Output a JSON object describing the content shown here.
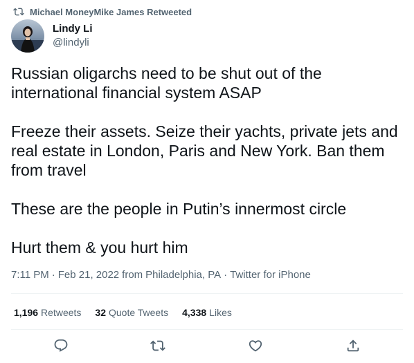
{
  "retweet_context": {
    "icon": "retweet-icon",
    "text": "Michael MoneyMike James Retweeted"
  },
  "author": {
    "display_name": "Lindy Li",
    "handle": "@lindyli",
    "avatar": "avatar-photo"
  },
  "tweet": {
    "paragraphs": [
      "Russian oligarchs need to be shut out of the international financial system ASAP",
      "Freeze their assets. Seize their yachts, private jets and real estate in London, Paris and New York. Ban them from travel",
      "These are the people in Putin’s innermost circle",
      "Hurt them & you hurt him"
    ]
  },
  "meta": {
    "time": "7:11 PM",
    "date": "Feb 21, 2022",
    "location_prefix": "from",
    "location": "Philadelphia, PA",
    "source": "Twitter for iPhone",
    "separator": "·"
  },
  "stats": {
    "retweets_count": "1,196",
    "retweets_label": "Retweets",
    "quotes_count": "32",
    "quotes_label": "Quote Tweets",
    "likes_count": "4,338",
    "likes_label": "Likes"
  },
  "actions": [
    {
      "name": "reply",
      "icon": "reply-icon"
    },
    {
      "name": "retweet",
      "icon": "retweet-icon"
    },
    {
      "name": "like",
      "icon": "heart-icon"
    },
    {
      "name": "share",
      "icon": "share-icon"
    }
  ],
  "colors": {
    "text_primary": "#0f1419",
    "text_secondary": "#536471",
    "divider": "#eff3f4"
  }
}
